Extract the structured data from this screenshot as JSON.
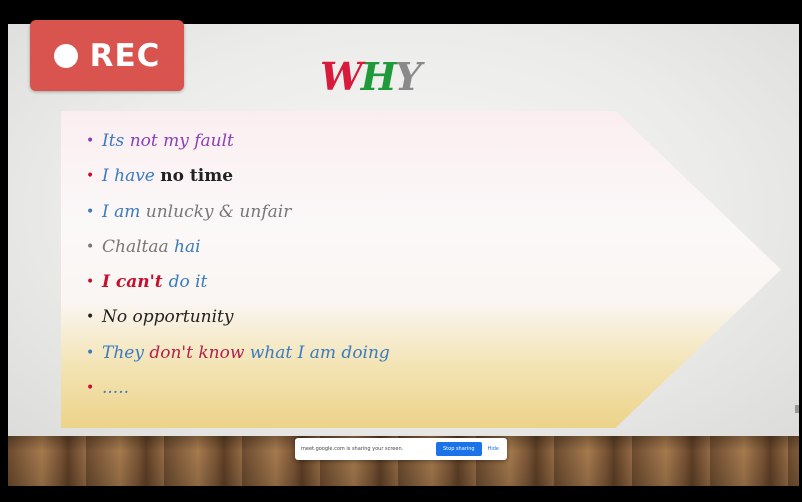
{
  "recording": {
    "label": "REC"
  },
  "slide": {
    "title_letters": [
      "W",
      "H",
      "Y"
    ],
    "items": [
      {
        "segments": [
          {
            "text": "Its ",
            "color": "blue"
          },
          {
            "text": "not my fault",
            "color": "purple"
          }
        ],
        "bullet_color": "purple"
      },
      {
        "segments": [
          {
            "text": "I have ",
            "color": "blue"
          },
          {
            "text": "no time",
            "color": "black-bold"
          }
        ],
        "bullet_color": "red"
      },
      {
        "segments": [
          {
            "text": "I am ",
            "color": "blue"
          },
          {
            "text": "unlucky & unfair",
            "color": "gray"
          }
        ],
        "bullet_color": "blue"
      },
      {
        "segments": [
          {
            "text": "Chaltaa ",
            "color": "gray"
          },
          {
            "text": "hai",
            "color": "blue"
          }
        ],
        "bullet_color": "gray"
      },
      {
        "segments": [
          {
            "text": "I can't ",
            "color": "red"
          },
          {
            "text": "do it",
            "color": "blue"
          }
        ],
        "bullet_color": "red"
      },
      {
        "segments": [
          {
            "text": "No opportunity",
            "color": "black"
          }
        ],
        "bullet_color": "black"
      },
      {
        "segments": [
          {
            "text": "They ",
            "color": "blue"
          },
          {
            "text": "don't know ",
            "color": "crimson"
          },
          {
            "text": "what I am doing",
            "color": "blue"
          }
        ],
        "bullet_color": "blue"
      },
      {
        "segments": [
          {
            "text": ".....",
            "color": "blue"
          }
        ],
        "bullet_color": "red"
      }
    ]
  },
  "share_bar": {
    "message": "meet.google.com is sharing your screen.",
    "stop_label": "Stop sharing",
    "hide_label": "Hide"
  },
  "colors": {
    "rec_background": "#d9534f",
    "accent_blue": "#1a73e8"
  }
}
